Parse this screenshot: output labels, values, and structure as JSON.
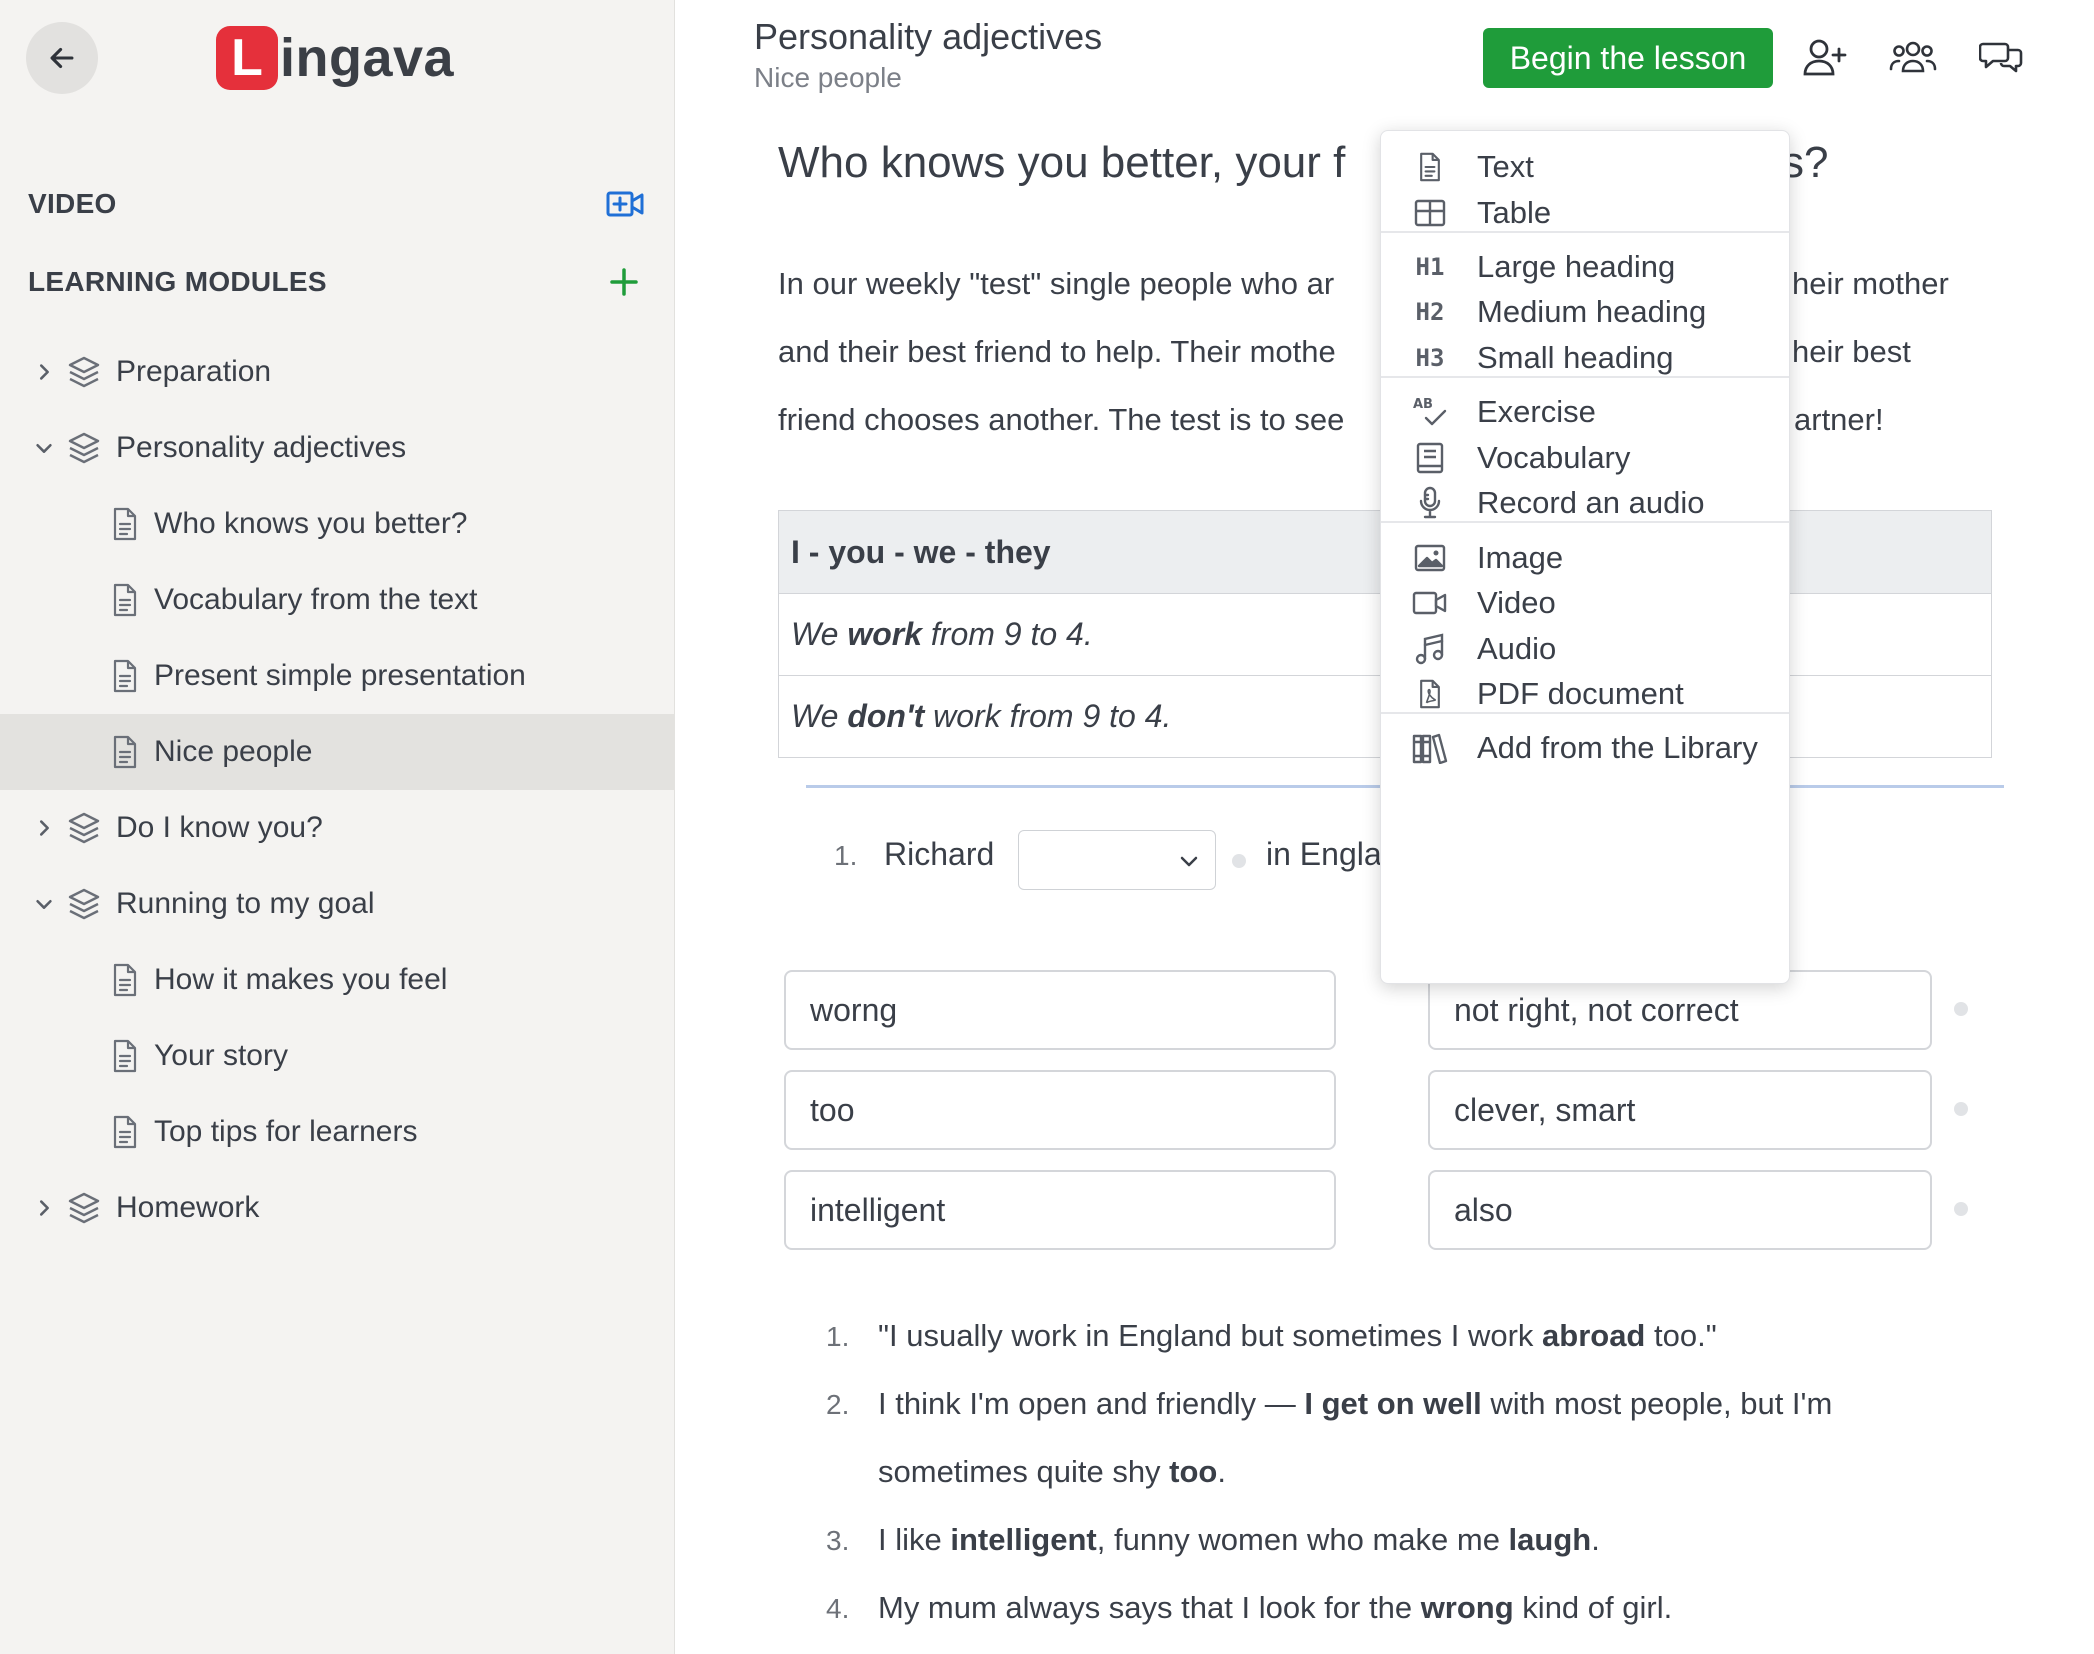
{
  "sidebar": {
    "logo_letter": "L",
    "logo_text": "ingava",
    "video_label": "VIDEO",
    "modules_label": "LEARNING MODULES",
    "tree": [
      {
        "label": "Preparation",
        "level": 1,
        "expanded": false
      },
      {
        "label": "Personality adjectives",
        "level": 1,
        "expanded": true
      },
      {
        "label": "Who knows you better?",
        "level": 2
      },
      {
        "label": "Vocabulary from the text",
        "level": 2
      },
      {
        "label": "Present simple presentation",
        "level": 2
      },
      {
        "label": "Nice people",
        "level": 2,
        "selected": true
      },
      {
        "label": "Do I know you?",
        "level": 1,
        "expanded": false
      },
      {
        "label": "Running to my goal",
        "level": 1,
        "expanded": true
      },
      {
        "label": "How it makes you feel",
        "level": 2
      },
      {
        "label": "Your story",
        "level": 2
      },
      {
        "label": "Top tips for learners",
        "level": 2
      },
      {
        "label": "Homework",
        "level": 1,
        "expanded": false
      }
    ]
  },
  "header": {
    "title": "Personality adjectives",
    "subtitle": "Nice people",
    "begin_label": "Begin the lesson"
  },
  "content": {
    "heading_start": "Who knows you better, your f",
    "heading_end": "s?",
    "para_lines_left": [
      "In our weekly \"test\" single people who ar",
      "and their best friend to help. Their mothe",
      "friend chooses another. The test is to see"
    ],
    "para_lines_right": [
      "heir mother",
      "heir best",
      "artner!"
    ],
    "table": {
      "header": "I - you - we - they",
      "rows": [
        {
          "pre": "We ",
          "bold": "work",
          "post": " from 9 to 4."
        },
        {
          "pre": "We ",
          "bold": "don't",
          "post": " work from 9 to 4."
        }
      ]
    },
    "exercise": {
      "num": "1.",
      "name": "Richard",
      "after": "in Engla"
    },
    "match_left": [
      "worng",
      "too",
      "intelligent"
    ],
    "match_right": [
      "not right, not correct",
      "clever, smart",
      "also"
    ],
    "list": [
      {
        "num": "1.",
        "parts": [
          [
            "\"I usually work in England but sometimes I work ",
            false
          ],
          [
            "abroad",
            true
          ],
          [
            " too.\"",
            false
          ]
        ]
      },
      {
        "num": "2.",
        "parts": [
          [
            "I think I'm open and friendly — ",
            false
          ],
          [
            "I get on well",
            true
          ],
          [
            " with most people, but I'm",
            false
          ]
        ]
      },
      {
        "num": "",
        "parts": [
          [
            "sometimes quite shy ",
            false
          ],
          [
            "too",
            true
          ],
          [
            ".",
            false
          ]
        ]
      },
      {
        "num": "3.",
        "parts": [
          [
            "I like ",
            false
          ],
          [
            "intelligent",
            true
          ],
          [
            ", funny women who make me ",
            false
          ],
          [
            "laugh",
            true
          ],
          [
            ".",
            false
          ]
        ]
      },
      {
        "num": "4.",
        "parts": [
          [
            "My mum always says that I look for the ",
            false
          ],
          [
            "wrong",
            true
          ],
          [
            " kind of girl.",
            false
          ]
        ]
      }
    ]
  },
  "menu": {
    "items": [
      {
        "icon": "doc",
        "label": "Text"
      },
      {
        "icon": "table",
        "label": "Table"
      },
      {
        "icon": "H1",
        "label": "Large heading"
      },
      {
        "icon": "H2",
        "label": "Medium heading"
      },
      {
        "icon": "H3",
        "label": "Small heading"
      },
      {
        "icon": "AB",
        "label": "Exercise"
      },
      {
        "icon": "book",
        "label": "Vocabulary"
      },
      {
        "icon": "mic",
        "label": "Record an audio"
      },
      {
        "icon": "image",
        "label": "Image"
      },
      {
        "icon": "video",
        "label": "Video"
      },
      {
        "icon": "music",
        "label": "Audio"
      },
      {
        "icon": "pdf",
        "label": "PDF document"
      },
      {
        "icon": "library",
        "label": "Add from the Library"
      }
    ]
  },
  "colors": {
    "brand_red": "#e5303b",
    "accent_green": "#1f9c3a",
    "video_blue": "#1f6fd6"
  }
}
